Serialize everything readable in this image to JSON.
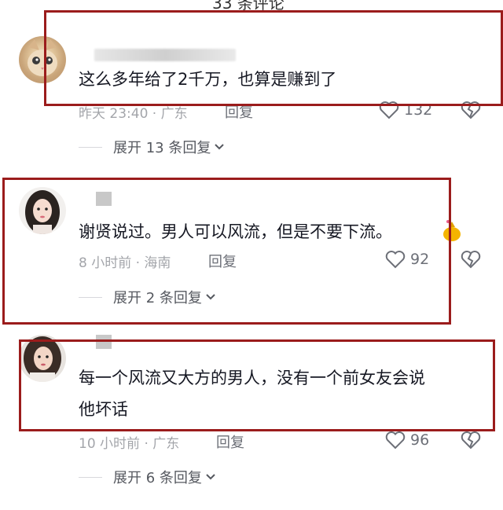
{
  "header": {
    "count_text": "33 条评论"
  },
  "comments": [
    {
      "text_lines": [
        "这么多年给了2千万，也算是赚到了"
      ],
      "time_location": "昨天 23:40 · 广东",
      "reply_label": "回复",
      "likes": "132",
      "expand_label": "展开 13 条回复"
    },
    {
      "text_lines": [
        "谢贤说过。男人可以风流，但是不要下流。"
      ],
      "time_location": "8 小时前 · 海南",
      "reply_label": "回复",
      "likes": "92",
      "expand_label": "展开 2 条回复"
    },
    {
      "text_lines": [
        "每一个风流又大方的男人，没有一个前女友会说",
        "他坏话"
      ],
      "time_location": "10 小时前 · 广东",
      "reply_label": "回复",
      "likes": "96",
      "expand_label": "展开 6 条回复"
    }
  ],
  "colors": {
    "highlight_border": "#9b1c1c",
    "meta_text": "#a3a5aa"
  },
  "icons": [
    "heart-outline-icon",
    "broken-heart-icon",
    "chevron-down-icon"
  ]
}
